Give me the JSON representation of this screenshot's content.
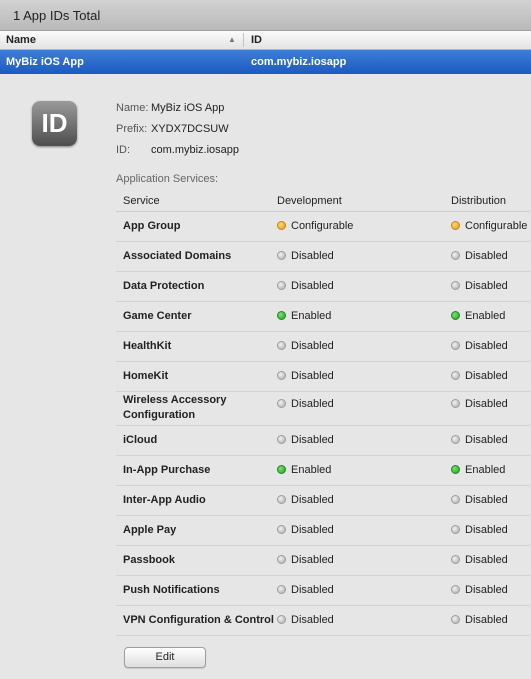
{
  "header": {
    "title": "1 App IDs Total"
  },
  "columns": {
    "name": "Name",
    "id": "ID"
  },
  "selected_row": {
    "name": "MyBiz iOS App",
    "bundle_id": "com.mybiz.iosapp"
  },
  "detail": {
    "icon_text": "ID",
    "name_label": "Name:",
    "name_value": "MyBiz iOS App",
    "prefix_label": "Prefix:",
    "prefix_value": "XYDX7DCSUW",
    "id_label": "ID:",
    "id_value": "com.mybiz.iosapp",
    "services_title": "Application Services:",
    "table_headers": {
      "service": "Service",
      "development": "Development",
      "distribution": "Distribution"
    },
    "services": [
      {
        "name": "App Group",
        "dev": "Configurable",
        "dev_status": "orange",
        "dist": "Configurable",
        "dist_status": "orange"
      },
      {
        "name": "Associated Domains",
        "dev": "Disabled",
        "dev_status": "gray",
        "dist": "Disabled",
        "dist_status": "gray"
      },
      {
        "name": "Data Protection",
        "dev": "Disabled",
        "dev_status": "gray",
        "dist": "Disabled",
        "dist_status": "gray"
      },
      {
        "name": "Game Center",
        "dev": "Enabled",
        "dev_status": "green",
        "dist": "Enabled",
        "dist_status": "green"
      },
      {
        "name": "HealthKit",
        "dev": "Disabled",
        "dev_status": "gray",
        "dist": "Disabled",
        "dist_status": "gray"
      },
      {
        "name": "HomeKit",
        "dev": "Disabled",
        "dev_status": "gray",
        "dist": "Disabled",
        "dist_status": "gray"
      },
      {
        "name": "Wireless Accessory Configuration",
        "dev": "Disabled",
        "dev_status": "gray",
        "dist": "Disabled",
        "dist_status": "gray"
      },
      {
        "name": "iCloud",
        "dev": "Disabled",
        "dev_status": "gray",
        "dist": "Disabled",
        "dist_status": "gray"
      },
      {
        "name": "In-App Purchase",
        "dev": "Enabled",
        "dev_status": "green",
        "dist": "Enabled",
        "dist_status": "green"
      },
      {
        "name": "Inter-App Audio",
        "dev": "Disabled",
        "dev_status": "gray",
        "dist": "Disabled",
        "dist_status": "gray"
      },
      {
        "name": "Apple Pay",
        "dev": "Disabled",
        "dev_status": "gray",
        "dist": "Disabled",
        "dist_status": "gray"
      },
      {
        "name": "Passbook",
        "dev": "Disabled",
        "dev_status": "gray",
        "dist": "Disabled",
        "dist_status": "gray"
      },
      {
        "name": "Push Notifications",
        "dev": "Disabled",
        "dev_status": "gray",
        "dist": "Disabled",
        "dist_status": "gray"
      },
      {
        "name": "VPN Configuration & Control",
        "dev": "Disabled",
        "dev_status": "gray",
        "dist": "Disabled",
        "dist_status": "gray"
      }
    ]
  },
  "buttons": {
    "edit": "Edit"
  }
}
